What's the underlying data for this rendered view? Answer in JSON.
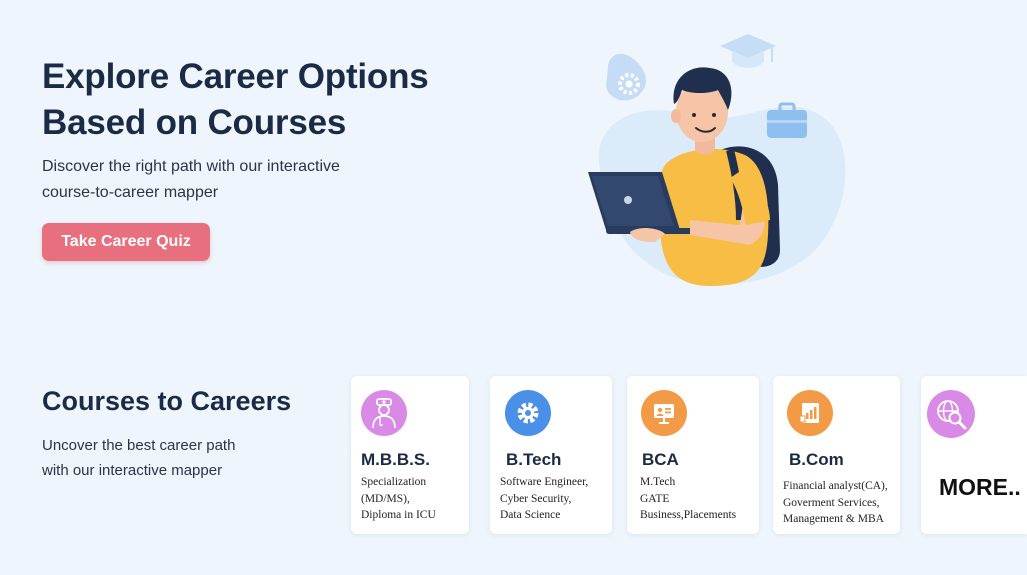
{
  "hero": {
    "title_line1": "Explore Career Options",
    "title_line2": "Based on Courses",
    "subtitle_line1": "Discover the right path with our interactive",
    "subtitle_line2": "course-to-career mapper",
    "cta_label": "Take Career Quiz"
  },
  "courses": {
    "title": "Courses to Careers",
    "subtitle_line1": "Uncover the best career path",
    "subtitle_line2": "with our interactive mapper",
    "cards": [
      {
        "title": "M.B.B.S.",
        "lines": [
          "Specialization",
          "(MD/MS),",
          "Diploma in ICU"
        ],
        "icon": "doctor-icon",
        "color": "#d98ae6"
      },
      {
        "title": "B.Tech",
        "lines": [
          "Software Engineer,",
          "Cyber Security,",
          "Data Science"
        ],
        "icon": "gear-icon",
        "color": "#4a90e8"
      },
      {
        "title": "BCA",
        "lines": [
          "M.Tech",
          "GATE",
          "Business,Placements"
        ],
        "icon": "presentation-icon",
        "color": "#f29a45"
      },
      {
        "title": "B.Com",
        "lines": [
          "Financial analyst(CA),",
          "Goverment Services,",
          "Management & MBA"
        ],
        "icon": "chart-report-icon",
        "color": "#f29a45"
      }
    ],
    "more_label": "MORE..",
    "more_icon_color": "#d98ae6"
  },
  "colors": {
    "background": "#eef5fc",
    "accent": "#e8707e",
    "heading": "#1c2b45"
  }
}
